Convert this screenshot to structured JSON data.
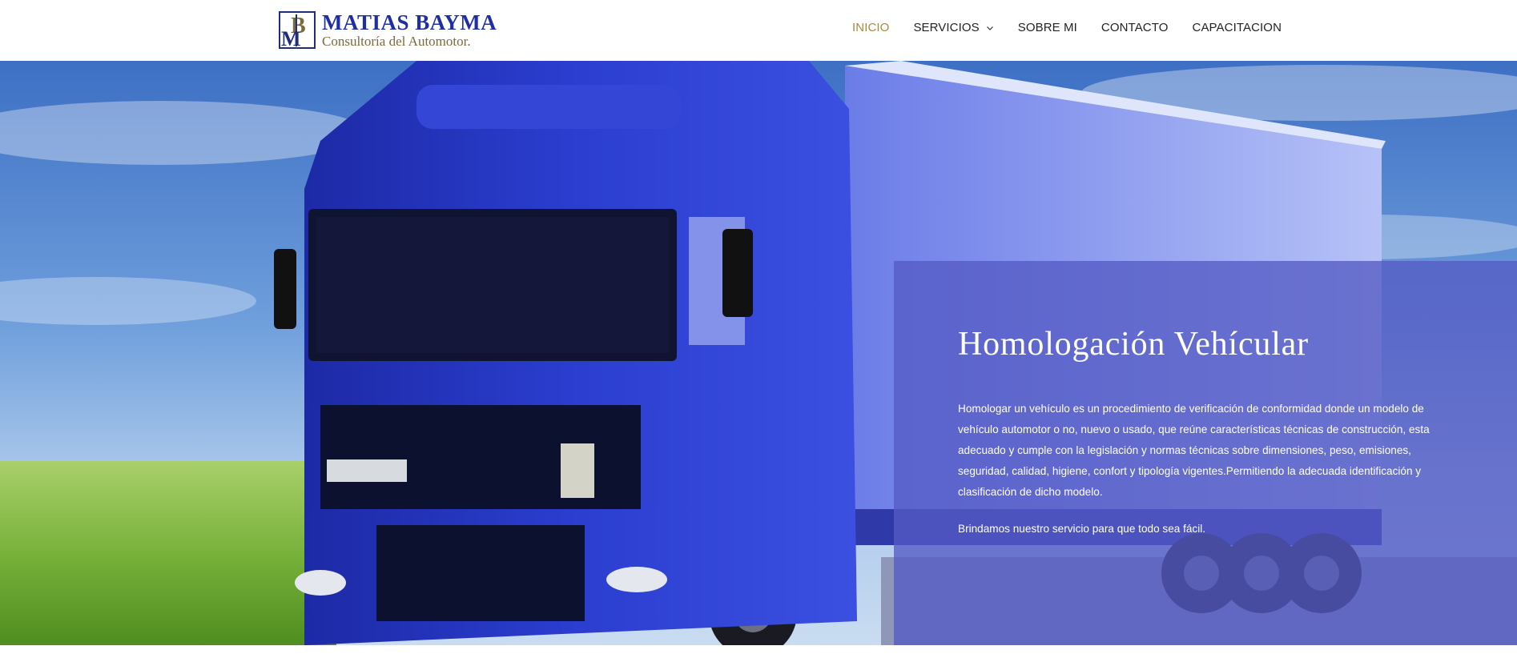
{
  "brand": {
    "name": "MATIAS BAYMA",
    "tagline": "Consultoría del Automotor."
  },
  "nav": {
    "items": [
      {
        "label": "INICIO",
        "active": true
      },
      {
        "label": "SERVICIOS",
        "has_dropdown": true
      },
      {
        "label": "SOBRE MI"
      },
      {
        "label": "CONTACTO"
      },
      {
        "label": "CAPACITACION"
      }
    ],
    "dropdown_icon": "chevron-down-icon"
  },
  "hero": {
    "title": "Homologación Vehícular",
    "body": "Homologar un vehículo es un procedimiento de verificación de conformidad donde un modelo de vehículo automotor o no, nuevo o usado, que reúne características técnicas de construcción, esta adecuado y cumple con la legislación y normas técnicas sobre dimensiones, peso, emisiones, seguridad, calidad, higiene, confort y tipología vigentes.Permitiendo la adecuada identificación y clasificación de dicho modelo.",
    "tagline": "Brindamos nuestro servicio para que todo sea fácil."
  },
  "colors": {
    "brand_blue": "#1f2fa3",
    "brand_gold": "#7c6a3c",
    "nav_active": "#a98a3b",
    "panel_overlay": "#545bc4"
  }
}
